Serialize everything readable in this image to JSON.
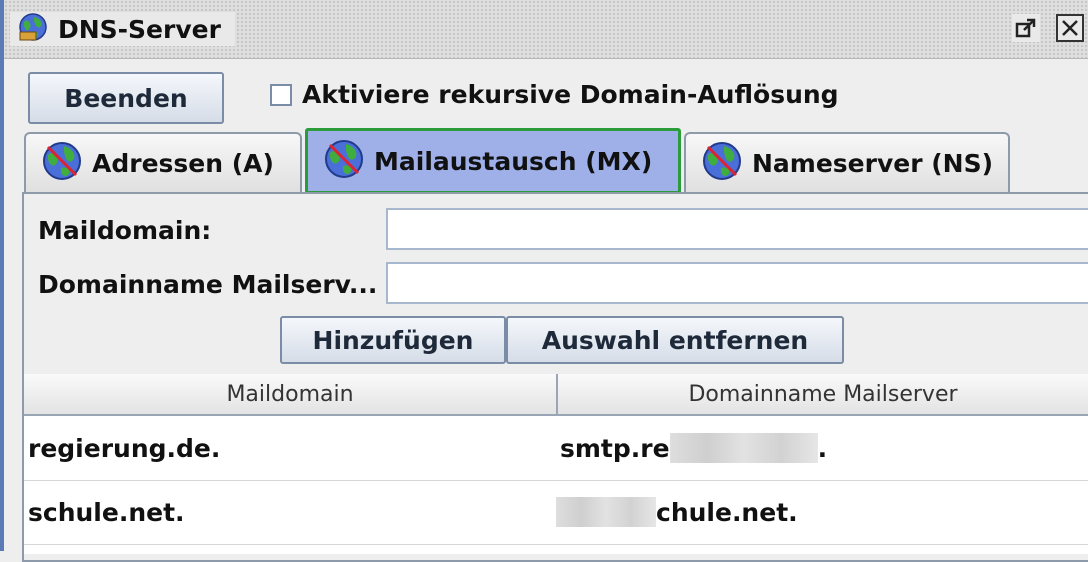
{
  "window": {
    "title": "DNS-Server",
    "icons": {
      "app": "globe-dns-icon",
      "maximize": "maximize-icon",
      "close": "close-icon"
    }
  },
  "toolbar": {
    "quit_label": "Beenden",
    "recursive_label": "Aktiviere rekursive Domain-Auflösung",
    "recursive_checked": false
  },
  "tabs": [
    {
      "label": "Adressen (A)",
      "icon": "globe-icon",
      "selected": false
    },
    {
      "label": "Mailaustausch (MX)",
      "icon": "globe-icon",
      "selected": true
    },
    {
      "label": "Nameserver (NS)",
      "icon": "globe-icon",
      "selected": false
    }
  ],
  "form": {
    "maildomain_label": "Maildomain:",
    "maildomain_value": "",
    "mailserver_label": "Domainname Mailserv...",
    "mailserver_value": "",
    "add_label": "Hinzufügen",
    "remove_label": "Auswahl entfernen"
  },
  "table": {
    "columns": [
      "Maildomain",
      "Domainname Mailserver"
    ],
    "rows": [
      {
        "maildomain": "regierung.de.",
        "mailserver_start": "smtp.re",
        "mailserver_end": "."
      },
      {
        "maildomain": "schule.net.",
        "mailserver_start": "",
        "mailserver_end": "chule.net."
      }
    ]
  },
  "colors": {
    "selected_tab_bg": "#9fb0e9",
    "selected_tab_border": "#2a9d3a",
    "window_border": "#5a7ab8"
  }
}
